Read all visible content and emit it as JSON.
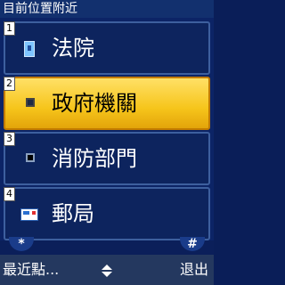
{
  "title": "目前位置附近",
  "items": [
    {
      "number": "1",
      "label": "法院",
      "icon": "court-icon",
      "selected": false
    },
    {
      "number": "2",
      "label": "政府機關",
      "icon": "building-icon",
      "selected": true
    },
    {
      "number": "3",
      "label": "消防部門",
      "icon": "fire-station-icon",
      "selected": false
    },
    {
      "number": "4",
      "label": "郵局",
      "icon": "post-office-icon",
      "selected": false
    }
  ],
  "softkeys": {
    "star": "*",
    "hash": "#",
    "left": "最近點...",
    "right": "退出"
  },
  "colors": {
    "background": "#0c2466",
    "selected": "#f6c51b",
    "softbar": "#24385f"
  }
}
